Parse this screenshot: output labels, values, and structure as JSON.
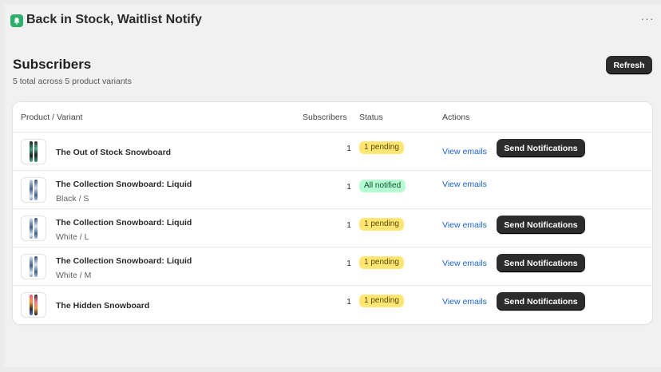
{
  "app": {
    "title": "Back in Stock, Waitlist Notify",
    "more_icon": "ellipsis-icon",
    "brand_color": "#2eae6b"
  },
  "page": {
    "title": "Subscribers",
    "subtitle": "5 total across 5 product variants",
    "refresh_label": "Refresh"
  },
  "table": {
    "headers": [
      "Product / Variant",
      "Subscribers",
      "Status",
      "Actions"
    ],
    "rows": [
      {
        "name": "The Out of Stock Snowboard",
        "variant": "",
        "subscribers": "1",
        "status": "1 pending",
        "status_type": "pending",
        "view_label": "View emails",
        "send_label": "Send Notifications"
      },
      {
        "name": "The Collection Snowboard: Liquid",
        "variant": "Black / S",
        "subscribers": "1",
        "status": "All notified",
        "status_type": "notified",
        "view_label": "View emails",
        "send_label": ""
      },
      {
        "name": "The Collection Snowboard: Liquid",
        "variant": "White / L",
        "subscribers": "1",
        "status": "1 pending",
        "status_type": "pending",
        "view_label": "View emails",
        "send_label": "Send Notifications"
      },
      {
        "name": "The Collection Snowboard: Liquid",
        "variant": "White / M",
        "subscribers": "1",
        "status": "1 pending",
        "status_type": "pending",
        "view_label": "View emails",
        "send_label": "Send Notifications"
      },
      {
        "name": "The Hidden Snowboard",
        "variant": "",
        "subscribers": "1",
        "status": "1 pending",
        "status_type": "pending",
        "view_label": "View emails",
        "send_label": "Send Notifications"
      }
    ]
  },
  "colors": {
    "pending_badge": "#ffe675",
    "notified_badge": "#b4fed2",
    "link": "#1f63c4",
    "primary_button": "#2c2c2c"
  }
}
